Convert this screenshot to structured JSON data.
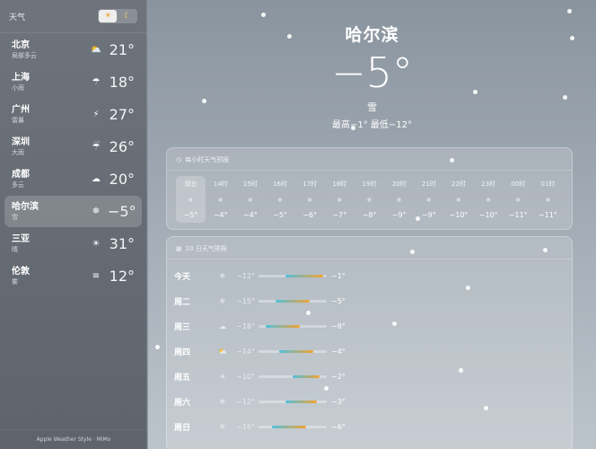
{
  "sidebar": {
    "title": "天气",
    "toggle": {
      "day_icon": "☀",
      "night_icon": "☾"
    },
    "cities": [
      {
        "name": "北京",
        "cond": "局部多云",
        "icon": "partly-cloudy-icon",
        "glyph": "⛅",
        "temp": "21°"
      },
      {
        "name": "上海",
        "cond": "小雨",
        "icon": "rain-icon",
        "glyph": "☂",
        "temp": "18°"
      },
      {
        "name": "广州",
        "cond": "雷暴",
        "icon": "thunder-icon",
        "glyph": "⚡",
        "temp": "27°"
      },
      {
        "name": "深圳",
        "cond": "大雨",
        "icon": "heavy-rain-icon",
        "glyph": "☔",
        "temp": "26°"
      },
      {
        "name": "成都",
        "cond": "多云",
        "icon": "cloud-icon",
        "glyph": "☁",
        "temp": "20°"
      },
      {
        "name": "哈尔滨",
        "cond": "雪",
        "icon": "snow-icon",
        "glyph": "❄",
        "temp": "−5°"
      },
      {
        "name": "三亚",
        "cond": "晴",
        "icon": "sun-icon",
        "glyph": "☀",
        "temp": "31°"
      },
      {
        "name": "伦敦",
        "cond": "雾",
        "icon": "fog-icon",
        "glyph": "≡",
        "temp": "12°"
      }
    ],
    "selected_index": 5,
    "footer": "Apple Weather Style · MiMo"
  },
  "current": {
    "city": "哈尔滨",
    "temp": "−5°",
    "condition": "雪",
    "range": "最高−1° 最低−12°"
  },
  "hourly": {
    "title": "每小时天气预报",
    "title_icon": "clock-icon",
    "hours": [
      {
        "label": "现在",
        "temp": "−5°"
      },
      {
        "label": "14时",
        "temp": "−4°"
      },
      {
        "label": "15时",
        "temp": "−4°"
      },
      {
        "label": "16时",
        "temp": "−5°"
      },
      {
        "label": "17时",
        "temp": "−6°"
      },
      {
        "label": "18时",
        "temp": "−7°"
      },
      {
        "label": "19时",
        "temp": "−8°"
      },
      {
        "label": "20时",
        "temp": "−9°"
      },
      {
        "label": "21时",
        "temp": "−9°"
      },
      {
        "label": "22时",
        "temp": "−10°"
      },
      {
        "label": "23时",
        "temp": "−10°"
      },
      {
        "label": "00时",
        "temp": "−11°"
      },
      {
        "label": "01时",
        "temp": "−11°"
      }
    ]
  },
  "daily": {
    "title": "10 日天气预报",
    "title_icon": "calendar-icon",
    "range_min": -20,
    "range_max": 0,
    "days": [
      {
        "name": "今天",
        "icon": "snow-icon",
        "glyph": "❄",
        "low": "−12°",
        "high": "−1°",
        "low_val": -12,
        "high_val": -1
      },
      {
        "name": "周二",
        "icon": "snow-icon",
        "glyph": "❄",
        "low": "−15°",
        "high": "−5°",
        "low_val": -15,
        "high_val": -5
      },
      {
        "name": "周三",
        "icon": "cloud-icon",
        "glyph": "☁",
        "low": "−18°",
        "high": "−8°",
        "low_val": -18,
        "high_val": -8
      },
      {
        "name": "周四",
        "icon": "partly-cloudy-icon",
        "glyph": "⛅",
        "low": "−14°",
        "high": "−4°",
        "low_val": -14,
        "high_val": -4
      },
      {
        "name": "周五",
        "icon": "sun-icon",
        "glyph": "☀",
        "low": "−10°",
        "high": "−2°",
        "low_val": -10,
        "high_val": -2
      },
      {
        "name": "周六",
        "icon": "snow-icon",
        "glyph": "❄",
        "low": "−12°",
        "high": "−3°",
        "low_val": -12,
        "high_val": -3
      },
      {
        "name": "周日",
        "icon": "snow-icon",
        "glyph": "❄",
        "low": "−16°",
        "high": "−6°",
        "low_val": -16,
        "high_val": -6
      }
    ]
  }
}
